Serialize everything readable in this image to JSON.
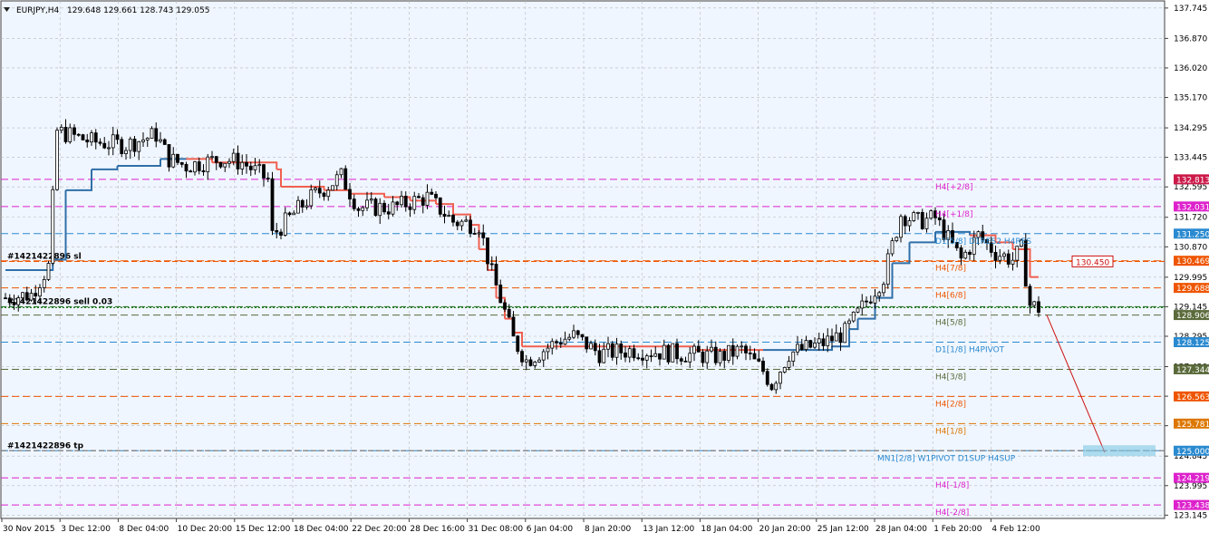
{
  "header": {
    "symbol": "EURJPY,H4",
    "ohlc": "129.648 129.661 128.743 129.055"
  },
  "colors": {
    "background": "#f0f6ff",
    "grid": "#b8b8b8",
    "candle": "#000000",
    "trail_up": "#2f6fa8",
    "trail_down": "#f06050",
    "magenta": "#dd22cc",
    "orange": "#ee5500",
    "dark_orange": "#dd7700",
    "blue": "#2a8ad0",
    "olive": "#5a6a3a",
    "dark_green": "#2a7a2a",
    "crimson": "#cc1a4a"
  },
  "chart_data": {
    "type": "candlestick",
    "ylim": [
      123.05,
      137.95
    ],
    "y_ticks": [
      "137.745",
      "136.870",
      "136.020",
      "135.170",
      "134.295",
      "133.445",
      "132.595",
      "131.720",
      "130.870",
      "129.995",
      "129.145",
      "128.295",
      "127.420",
      "126.570",
      "125.720",
      "124.845",
      "123.995",
      "123.145"
    ],
    "x_ticks": [
      "30 Nov 2015",
      "3 Dec 12:00",
      "8 Dec 04:00",
      "10 Dec 20:00",
      "15 Dec 12:00",
      "18 Dec 04:00",
      "22 Dec 20:00",
      "28 Dec 16:00",
      "31 Dec 08:00",
      "6 Jan 04:00",
      "8 Jan 20:00",
      "13 Jan 12:00",
      "18 Jan 04:00",
      "20 Jan 20:00",
      "25 Jan 12:00",
      "28 Jan 04:00",
      "1 Feb 20:00",
      "4 Feb 12:00"
    ],
    "close_path": [
      [
        0,
        129.4
      ],
      [
        6,
        129.5
      ],
      [
        10,
        130.3
      ],
      [
        12,
        134.2
      ],
      [
        20,
        133.9
      ],
      [
        28,
        133.8
      ],
      [
        35,
        134.1
      ],
      [
        38,
        133.4
      ],
      [
        42,
        133.2
      ],
      [
        50,
        133.4
      ],
      [
        55,
        133.3
      ],
      [
        61,
        132.8
      ],
      [
        62,
        131.2
      ],
      [
        70,
        132.2
      ],
      [
        78,
        132.9
      ],
      [
        82,
        132.0
      ],
      [
        90,
        132.0
      ],
      [
        98,
        132.3
      ],
      [
        104,
        131.6
      ],
      [
        110,
        131.5
      ],
      [
        113,
        130.1
      ],
      [
        116,
        129.0
      ],
      [
        118,
        128.2
      ],
      [
        121,
        127.6
      ],
      [
        125,
        127.9
      ],
      [
        129,
        128.2
      ],
      [
        132,
        128.3
      ],
      [
        138,
        127.8
      ],
      [
        146,
        127.9
      ],
      [
        156,
        127.8
      ],
      [
        166,
        127.7
      ],
      [
        171,
        127.9
      ],
      [
        176,
        127.3
      ],
      [
        178,
        126.9
      ],
      [
        182,
        127.8
      ],
      [
        190,
        128.1
      ],
      [
        195,
        128.4
      ],
      [
        200,
        129.3
      ],
      [
        204,
        130.0
      ],
      [
        208,
        131.8
      ],
      [
        212,
        131.6
      ],
      [
        216,
        131.7
      ],
      [
        220,
        130.9
      ],
      [
        222,
        130.5
      ],
      [
        226,
        131.2
      ],
      [
        230,
        130.7
      ],
      [
        234,
        130.5
      ],
      [
        236,
        130.8
      ],
      [
        238,
        129.2
      ],
      [
        240,
        129.1
      ]
    ],
    "trail_line": [
      [
        0,
        130.2,
        "up"
      ],
      [
        8,
        130.2,
        "up"
      ],
      [
        11,
        130.5,
        "up"
      ],
      [
        14,
        132.5,
        "up"
      ],
      [
        20,
        133.1,
        "up"
      ],
      [
        26,
        133.2,
        "up"
      ],
      [
        36,
        133.4,
        "up"
      ],
      [
        40,
        133.4,
        "up"
      ],
      [
        42,
        133.4,
        "down"
      ],
      [
        48,
        133.3,
        "down"
      ],
      [
        56,
        133.3,
        "down"
      ],
      [
        63,
        133.1,
        "down"
      ],
      [
        64,
        132.6,
        "down"
      ],
      [
        74,
        132.5,
        "down"
      ],
      [
        80,
        132.4,
        "down"
      ],
      [
        88,
        132.3,
        "down"
      ],
      [
        94,
        132.2,
        "down"
      ],
      [
        100,
        132.1,
        "down"
      ],
      [
        104,
        131.8,
        "down"
      ],
      [
        108,
        131.5,
        "down"
      ],
      [
        110,
        130.8,
        "down"
      ],
      [
        112,
        130.2,
        "down"
      ],
      [
        114,
        129.4,
        "down"
      ],
      [
        116,
        128.8,
        "down"
      ],
      [
        118,
        128.4,
        "down"
      ],
      [
        120,
        128.0,
        "down"
      ],
      [
        150,
        128.0,
        "down"
      ],
      [
        160,
        127.9,
        "down"
      ],
      [
        172,
        127.9,
        "down"
      ],
      [
        176,
        127.9,
        "down"
      ],
      [
        176,
        127.9,
        "up"
      ],
      [
        186,
        127.9,
        "up"
      ],
      [
        192,
        128.0,
        "up"
      ],
      [
        196,
        128.5,
        "up"
      ],
      [
        198,
        128.8,
        "up"
      ],
      [
        202,
        129.4,
        "up"
      ],
      [
        206,
        130.4,
        "up"
      ],
      [
        210,
        131.0,
        "up"
      ],
      [
        216,
        131.3,
        "up"
      ],
      [
        222,
        131.3,
        "up"
      ],
      [
        224,
        131.2,
        "up"
      ],
      [
        224,
        131.2,
        "down"
      ],
      [
        230,
        131.0,
        "down"
      ],
      [
        234,
        130.8,
        "down"
      ],
      [
        238,
        130.0,
        "down"
      ],
      [
        240,
        130.0,
        "down"
      ]
    ],
    "hlines": [
      {
        "price": 132.813,
        "label": "H4[+2/8]",
        "tag": "132.813",
        "color": "#dd22cc",
        "tag_bg": "#cc1a4a"
      },
      {
        "price": 132.031,
        "label": "H4[+1/8]",
        "tag": "132.031",
        "color": "#dd22cc",
        "tag_bg": "#dd22cc"
      },
      {
        "price": 131.25,
        "label": "D1[5/8] D1RES2 H4RES",
        "tag": "131.250",
        "color": "#2a8ad0",
        "tag_bg": "#2a8ad0"
      },
      {
        "price": 130.469,
        "label": "H4[7/8]",
        "tag": "130.469",
        "color": "#ee5500",
        "tag_bg": "#ee5500"
      },
      {
        "price": 129.688,
        "label": "H4[6/8]",
        "tag": "129.688",
        "color": "#ee5500",
        "tag_bg": "#ee5500"
      },
      {
        "price": 128.906,
        "label": "H4[5/8]",
        "tag": "128.906",
        "color": "#5a6a3a",
        "tag_bg": "#5a6a3a"
      },
      {
        "price": 128.125,
        "label": "D1[1/8] H4PIVOT",
        "tag": "128.125",
        "color": "#2a8ad0",
        "tag_bg": "#2a8ad0"
      },
      {
        "price": 127.344,
        "label": "H4[3/8]",
        "tag": "127.344",
        "color": "#5a6a3a",
        "tag_bg": "#5a6a3a"
      },
      {
        "price": 126.563,
        "label": "H4[2/8]",
        "tag": "126.563",
        "color": "#ee5500",
        "tag_bg": "#ee5500"
      },
      {
        "price": 125.781,
        "label": "H4[1/8]",
        "tag": "125.781",
        "color": "#dd7700",
        "tag_bg": "#dd7700"
      },
      {
        "price": 125.0,
        "label": "MN1[2/8] W1PIVOT D1SUP H4SUP",
        "tag": "125.000",
        "color": "#2a8ad0",
        "tag_bg": "#2a8ad0"
      },
      {
        "price": 124.219,
        "label": "H4[-1/8]",
        "tag": "124.219",
        "color": "#dd22cc",
        "tag_bg": "#dd22cc"
      },
      {
        "price": 123.438,
        "label": "H4[-2/8]",
        "tag": "123.438",
        "color": "#dd22cc",
        "tag_bg": "#dd22cc"
      }
    ],
    "order_lines": [
      {
        "price": 130.45,
        "label": "#1421422896 sl",
        "color": "#ee5500"
      },
      {
        "price": 129.145,
        "label": "#1421422896 sell 0.03",
        "color": "#2a7a2a"
      },
      {
        "price": 125.0,
        "label": "#1421422896 tp",
        "color": "#808080"
      }
    ],
    "sell_price": 129.12,
    "projection": {
      "from_bar": 240,
      "from_price": 128.906,
      "to_price": 124.95
    },
    "price_marker": "130.450"
  }
}
